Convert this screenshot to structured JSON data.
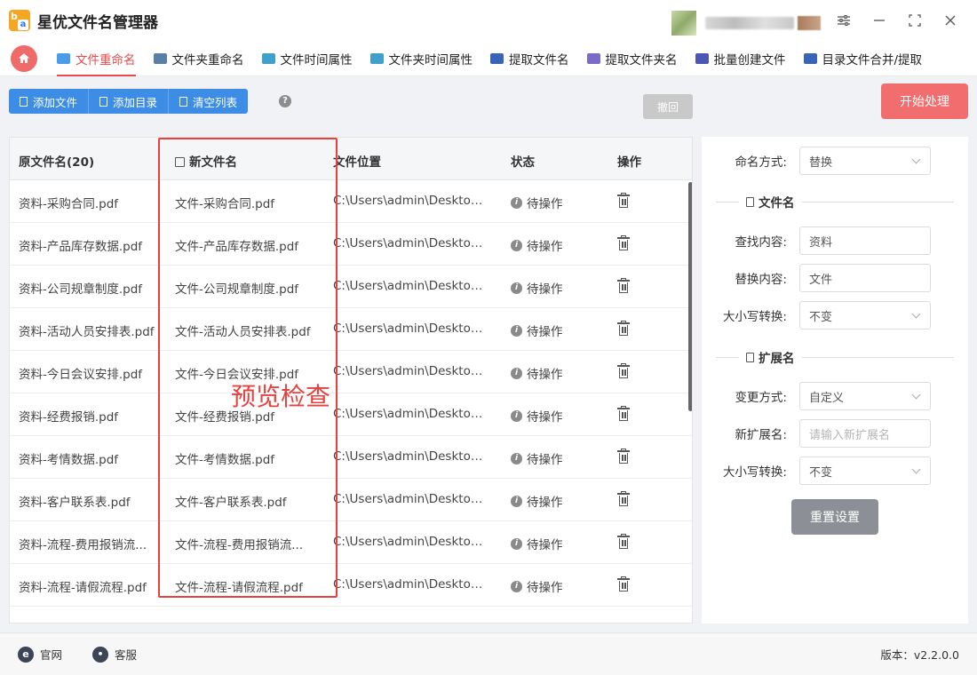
{
  "app": {
    "title": "星优文件名管理器"
  },
  "tabs": [
    {
      "label": "文件重命名",
      "active": true,
      "color": "#4a9be8"
    },
    {
      "label": "文件夹重命名",
      "active": false,
      "color": "#5b7fa6"
    },
    {
      "label": "文件时间属性",
      "active": false,
      "color": "#3fa1c9"
    },
    {
      "label": "文件夹时间属性",
      "active": false,
      "color": "#3fa1c9"
    },
    {
      "label": "提取文件名",
      "active": false,
      "color": "#3a64b8"
    },
    {
      "label": "提取文件夹名",
      "active": false,
      "color": "#7b6cc7"
    },
    {
      "label": "批量创建文件",
      "active": false,
      "color": "#4b56b5"
    },
    {
      "label": "目录文件合并/提取",
      "active": false,
      "color": "#3a64b8"
    }
  ],
  "toolbar": {
    "add_file": "添加文件",
    "add_dir": "添加目录",
    "clear_list": "清空列表",
    "help": "?",
    "undo": "撤回",
    "start": "开始处理"
  },
  "table": {
    "headers": {
      "original": "原文件名(20)",
      "new": "新文件名",
      "path": "文件位置",
      "status": "状态",
      "op": "操作"
    },
    "rows": [
      {
        "original": "资料-采购合同.pdf",
        "new": "文件-采购合同.pdf",
        "path": "C:\\Users\\admin\\Desktop\\...",
        "status": "待操作"
      },
      {
        "original": "资料-产品库存数据.pdf",
        "new": "文件-产品库存数据.pdf",
        "path": "C:\\Users\\admin\\Desktop\\...",
        "status": "待操作"
      },
      {
        "original": "资料-公司规章制度.pdf",
        "new": "文件-公司规章制度.pdf",
        "path": "C:\\Users\\admin\\Desktop\\...",
        "status": "待操作"
      },
      {
        "original": "资料-活动人员安排表.pdf",
        "new": "文件-活动人员安排表.pdf",
        "path": "C:\\Users\\admin\\Desktop\\...",
        "status": "待操作"
      },
      {
        "original": "资料-今日会议安排.pdf",
        "new": "文件-今日会议安排.pdf",
        "path": "C:\\Users\\admin\\Desktop\\...",
        "status": "待操作"
      },
      {
        "original": "资料-经费报销.pdf",
        "new": "文件-经费报销.pdf",
        "path": "C:\\Users\\admin\\Desktop\\...",
        "status": "待操作"
      },
      {
        "original": "资料-考情数据.pdf",
        "new": "文件-考情数据.pdf",
        "path": "C:\\Users\\admin\\Desktop\\...",
        "status": "待操作"
      },
      {
        "original": "资料-客户联系表.pdf",
        "new": "文件-客户联系表.pdf",
        "path": "C:\\Users\\admin\\Desktop\\...",
        "status": "待操作"
      },
      {
        "original": "资料-流程-费用报销流...",
        "new": "文件-流程-费用报销流...",
        "path": "C:\\Users\\admin\\Desktop\\...",
        "status": "待操作"
      },
      {
        "original": "资料-流程-请假流程.pdf",
        "new": "文件-流程-请假流程.pdf",
        "path": "C:\\Users\\admin\\Desktop\\...",
        "status": "待操作"
      }
    ]
  },
  "annotation": {
    "label": "预览检查",
    "color": "#e8413d"
  },
  "panel": {
    "naming_label": "命名方式:",
    "naming_value": "替换",
    "section_filename": "文件名",
    "find_label": "查找内容:",
    "find_value": "资料",
    "replace_label": "替换内容:",
    "replace_value": "文件",
    "case_label": "大小写转换:",
    "case_value": "不变",
    "section_ext": "扩展名",
    "change_label": "变更方式:",
    "change_value": "自定义",
    "newext_label": "新扩展名:",
    "newext_placeholder": "请输入新扩展名",
    "ext_case_label": "大小写转换:",
    "ext_case_value": "不变",
    "reset": "重置设置"
  },
  "statusbar": {
    "website": "官网",
    "service": "客服",
    "version": "版本：v2.2.0.0"
  },
  "colors": {
    "accent": "#e94a4a",
    "primary": "#3d8de6"
  }
}
